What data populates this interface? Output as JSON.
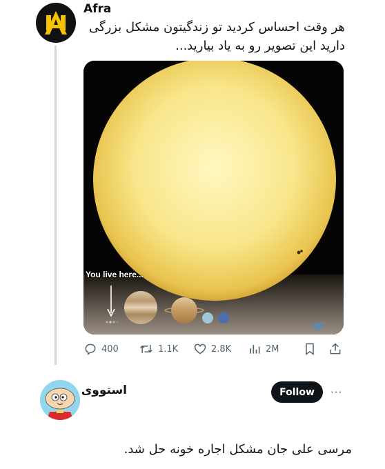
{
  "post": {
    "author": "Afra",
    "text_line1": "هر وقت احساس کردید تو زندگیتون مشکل بزرگی",
    "text_line2": "دارید این تصویر رو به یاد بیارید...",
    "media_caption": "You live here...",
    "stats": {
      "replies": "400",
      "reposts": "1.1K",
      "likes": "2.8K",
      "views": "2M"
    }
  },
  "reply": {
    "author": "استووی",
    "follow_label": "Follow",
    "more": "···",
    "text": "مرسی علی جان مشکل اجاره خونه حل شد."
  },
  "icons": [
    "reply-icon",
    "repost-icon",
    "like-icon",
    "views-icon",
    "bookmark-icon",
    "share-icon",
    "more-icon"
  ],
  "colors": {
    "text": "#0f1419",
    "muted": "#536471",
    "thread_line": "#cfd9de",
    "follow_bg": "#0f1419"
  }
}
